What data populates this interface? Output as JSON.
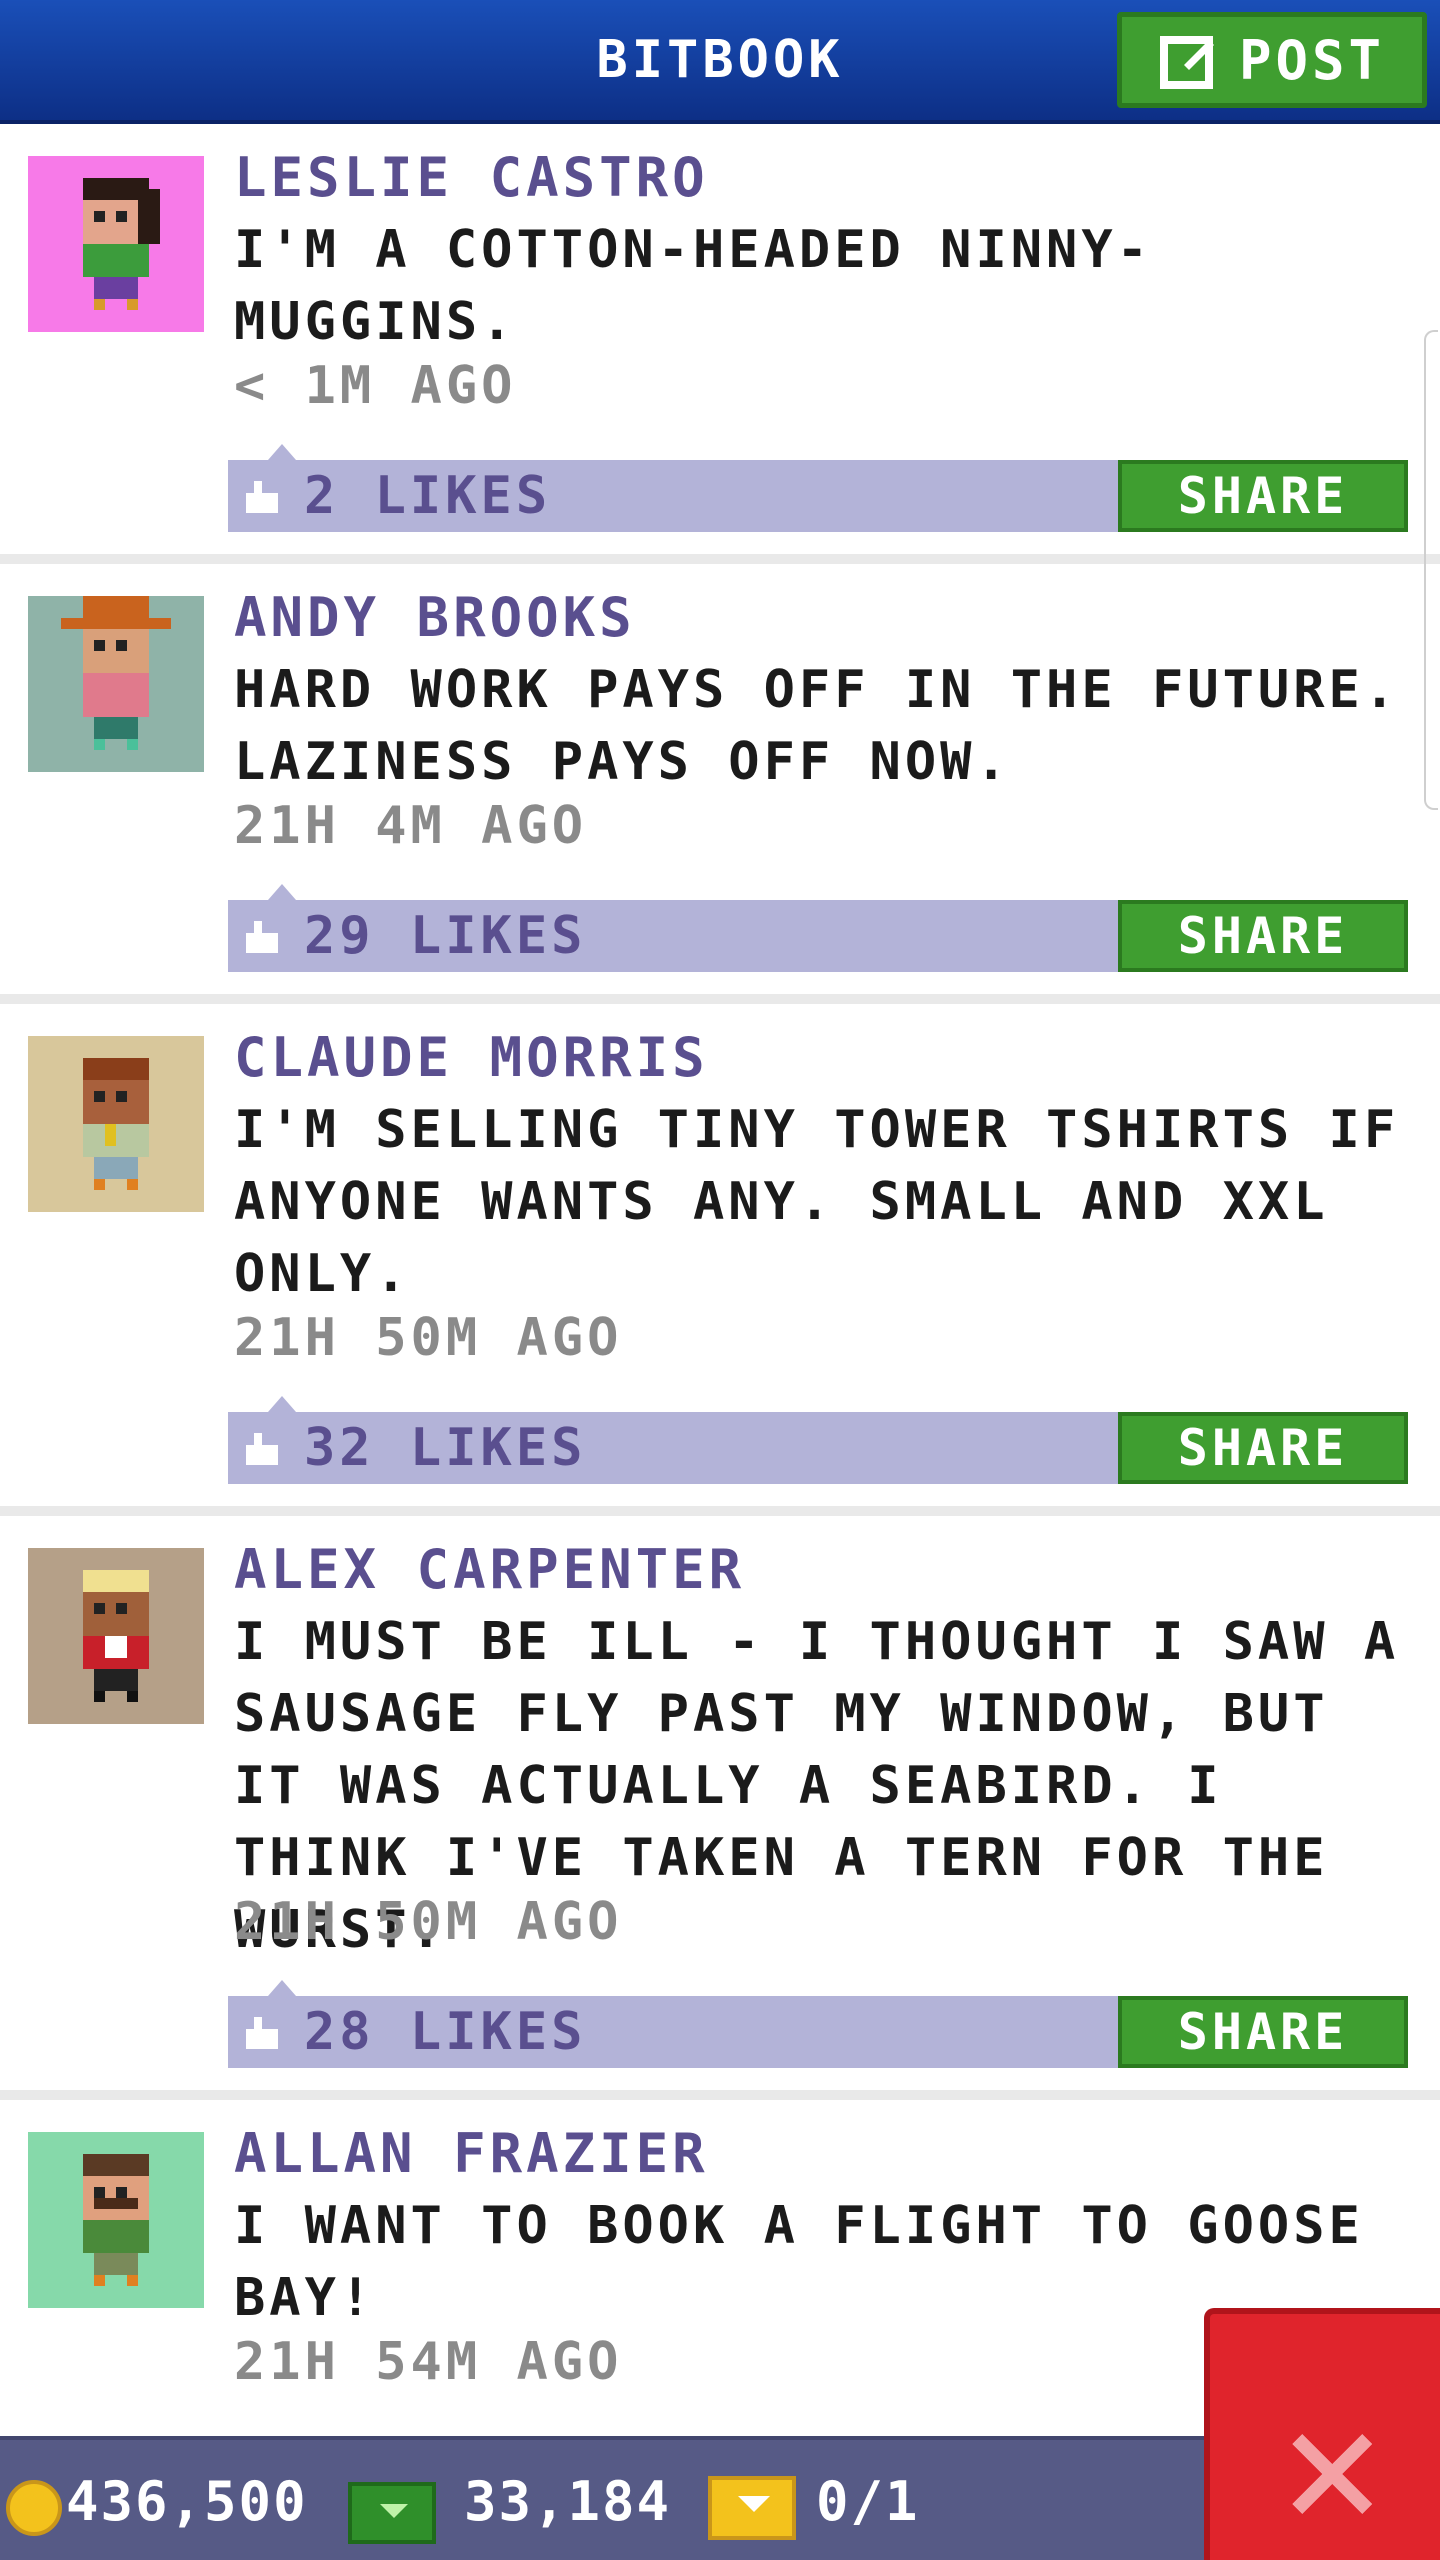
{
  "header": {
    "title": "BITBOOK",
    "post_label": "POST"
  },
  "posts": [
    {
      "name": "LESLIE CASTRO",
      "text": "I'M A COTTON-HEADED NINNY-MUGGINS.",
      "time": "< 1M AGO",
      "likes": "2 LIKES",
      "share": "SHARE",
      "avatar_bg": "#f77ae8"
    },
    {
      "name": "ANDY BROOKS",
      "text": "HARD WORK PAYS OFF IN THE FUTURE. LAZINESS PAYS OFF NOW.",
      "time": "21H 4M AGO",
      "likes": "29 LIKES",
      "share": "SHARE",
      "avatar_bg": "#8fb3a8"
    },
    {
      "name": "CLAUDE MORRIS",
      "text": "I'M SELLING TINY TOWER TSHIRTS IF ANYONE WANTS ANY. SMALL AND XXL ONLY.",
      "time": "21H 50M AGO",
      "likes": "32 LIKES",
      "share": "SHARE",
      "avatar_bg": "#d8c79b"
    },
    {
      "name": "ALEX CARPENTER",
      "text": "I MUST BE ILL - I THOUGHT I SAW A SAUSAGE FLY PAST MY WINDOW, BUT IT WAS ACTUALLY A SEABIRD. I THINK I'VE TAKEN A TERN FOR THE WURST.",
      "time": "21H 50M AGO",
      "likes": "28 LIKES",
      "share": "SHARE",
      "avatar_bg": "#b5a088"
    },
    {
      "name": "ALLAN FRAZIER",
      "text": "I WANT TO BOOK A FLIGHT TO GOOSE BAY!",
      "time": "21H 54M AGO",
      "avatar_bg": "#86d9aa"
    }
  ],
  "bottombar": {
    "coins": "436,500",
    "bux": "33,184",
    "tickets": "0/1"
  },
  "colors": {
    "header": "#1a4fb8",
    "accent_green": "#3f9e30",
    "name_purple": "#5a4f8f",
    "like_bar": "#b3b3d8",
    "close_red": "#e0242c"
  },
  "icons": [
    "compose-icon",
    "thumbs-up-icon",
    "coin-icon",
    "bux-icon",
    "ticket-icon",
    "close-icon"
  ]
}
